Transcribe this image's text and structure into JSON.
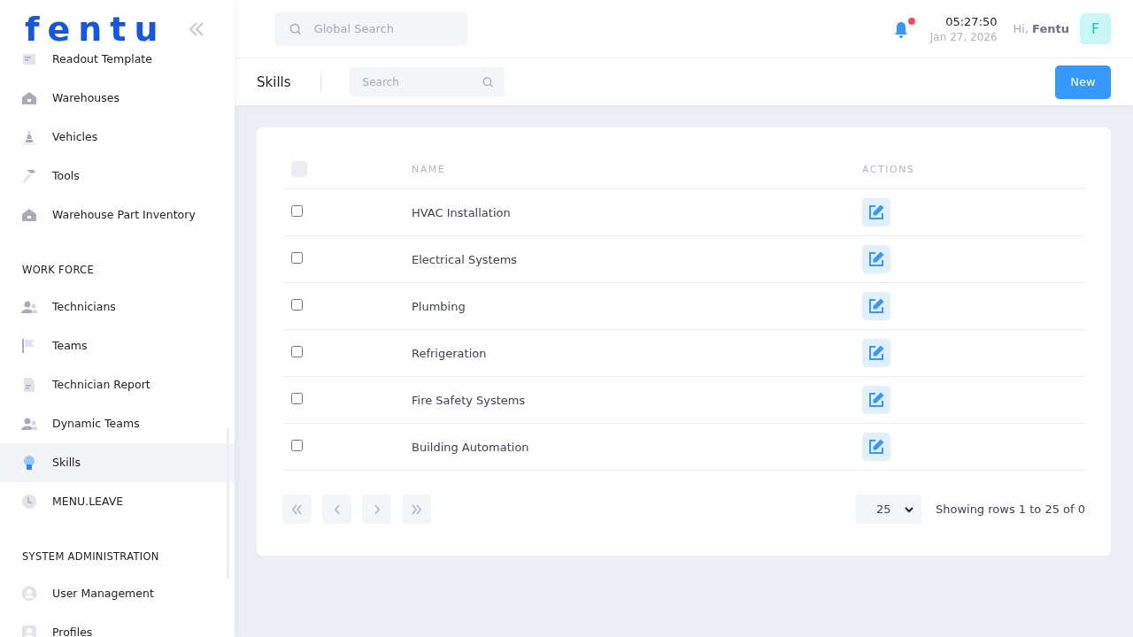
{
  "logo": "fentu",
  "sidebar": {
    "sections": [
      {
        "items": [
          {
            "label": "Readout Template",
            "selected": false
          },
          {
            "label": "Warehouses",
            "selected": false
          },
          {
            "label": "Vehicles",
            "selected": false
          },
          {
            "label": "Tools",
            "selected": false
          },
          {
            "label": "Warehouse Part Inventory",
            "selected": false
          }
        ]
      },
      {
        "title": "WORK FORCE",
        "items": [
          {
            "label": "Technicians",
            "selected": false
          },
          {
            "label": "Teams",
            "selected": false
          },
          {
            "label": "Technician Report",
            "selected": false
          },
          {
            "label": "Dynamic Teams",
            "selected": false
          },
          {
            "label": "Skills",
            "selected": true
          },
          {
            "label": "MENU.LEAVE",
            "selected": false
          }
        ]
      },
      {
        "title": "SYSTEM ADMINISTRATION",
        "items": [
          {
            "label": "User Management",
            "selected": false
          },
          {
            "label": "Profiles",
            "selected": false
          }
        ]
      }
    ]
  },
  "header": {
    "search": {
      "placeholder": "Global Search"
    },
    "time": "05:27:50",
    "date": "Jan 27, 2026",
    "greeting": "Hi,",
    "user": "Fentu",
    "avatar": "F"
  },
  "page": {
    "title": "Skills",
    "search": {
      "placeholder": "Search"
    },
    "new_button": "New"
  },
  "table": {
    "columns": [
      "NAME",
      "ACTIONS"
    ],
    "select_all": {
      "checked": false
    },
    "rows": [
      {
        "name": "HVAC Installation",
        "checked": false
      },
      {
        "name": "Electrical Systems",
        "checked": false
      },
      {
        "name": "Plumbing",
        "checked": false
      },
      {
        "name": "Refrigeration",
        "checked": false
      },
      {
        "name": "Fire Safety Systems",
        "checked": false
      },
      {
        "name": "Building Automation",
        "checked": false
      }
    ]
  },
  "pagination": {
    "page_size": "25",
    "summary": "Showing rows 1 to 25 of 0"
  }
}
